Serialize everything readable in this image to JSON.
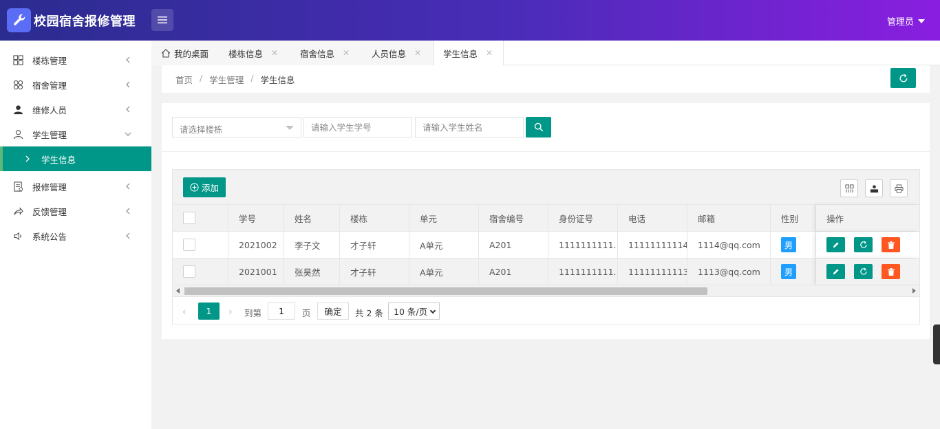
{
  "app": {
    "title": "校园宿舍报修管理",
    "user": "管理员"
  },
  "sidebar": {
    "items": [
      {
        "label": "楼栋管理",
        "icon": "grid-icon"
      },
      {
        "label": "宿舍管理",
        "icon": "clover-icon"
      },
      {
        "label": "维修人员",
        "icon": "user-solid-icon"
      },
      {
        "label": "学生管理",
        "icon": "user-outline-icon"
      },
      {
        "label": "学生信息",
        "icon": "chevron-right-icon"
      },
      {
        "label": "报修管理",
        "icon": "form-icon"
      },
      {
        "label": "反馈管理",
        "icon": "share-icon"
      },
      {
        "label": "系统公告",
        "icon": "speaker-icon"
      }
    ]
  },
  "tabs": [
    {
      "label": "我的桌面"
    },
    {
      "label": "楼栋信息"
    },
    {
      "label": "宿舍信息"
    },
    {
      "label": "人员信息"
    },
    {
      "label": "学生信息"
    }
  ],
  "breadcrumb": {
    "home": "首页",
    "parent": "学生管理",
    "current": "学生信息",
    "sep": "/"
  },
  "search": {
    "building_placeholder": "请选择楼栋",
    "student_id_placeholder": "请输入学生学号",
    "student_name_placeholder": "请输入学生姓名"
  },
  "toolbar": {
    "add_label": "添加"
  },
  "table": {
    "columns": [
      "学号",
      "姓名",
      "楼栋",
      "单元",
      "宿舍编号",
      "身份证号",
      "电话",
      "邮箱",
      "性别",
      "操作"
    ],
    "rows": [
      {
        "id": "2021002",
        "name": "李子文",
        "building": "才子轩",
        "unit": "A单元",
        "room": "A201",
        "idcard": "1111111111...",
        "phone": "11111111114",
        "email": "1114@qq.com",
        "gender": "男"
      },
      {
        "id": "2021001",
        "name": "张昊然",
        "building": "才子轩",
        "unit": "A单元",
        "room": "A201",
        "idcard": "1111111111...",
        "phone": "11111111113",
        "email": "1113@qq.com",
        "gender": "男"
      }
    ]
  },
  "pager": {
    "current_page": "1",
    "goto_label": "到第",
    "goto_value": "1",
    "page_label": "页",
    "confirm_label": "确定",
    "total_label": "共 2 条",
    "page_size": "10 条/页"
  },
  "colors": {
    "primary": "#009688",
    "danger": "#ff5722",
    "info": "#1e9fff"
  }
}
